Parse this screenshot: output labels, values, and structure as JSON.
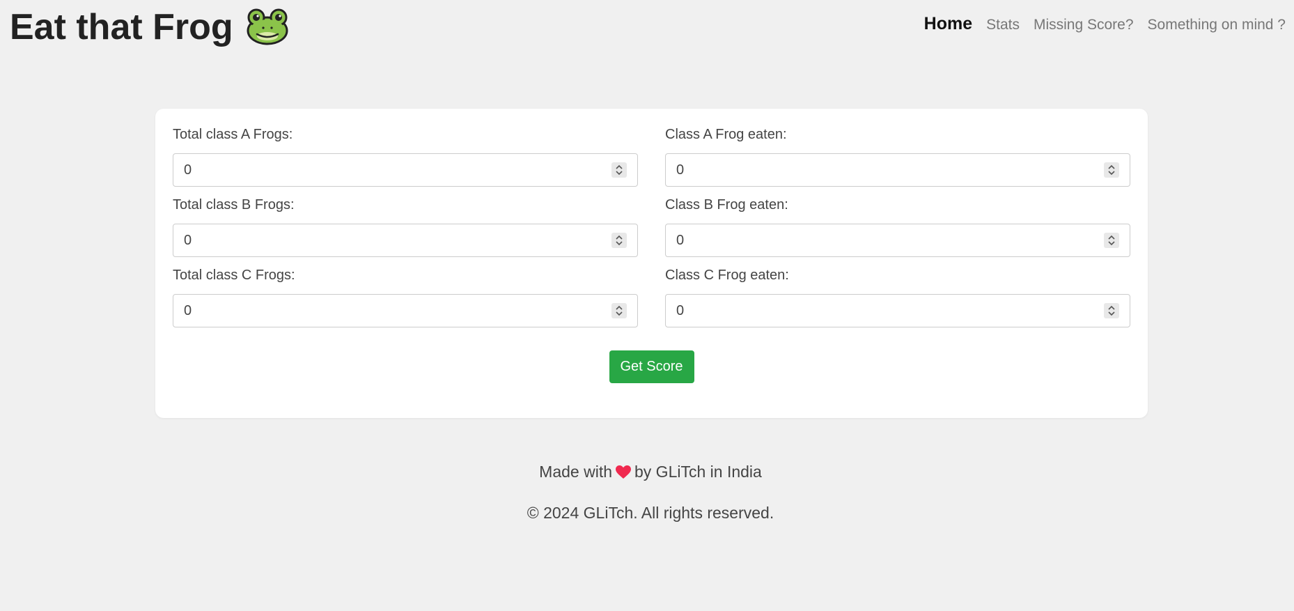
{
  "header": {
    "title": "Eat that Frog",
    "icon": "frog-face-icon"
  },
  "nav": {
    "items": [
      {
        "label": "Home",
        "active": true
      },
      {
        "label": "Stats",
        "active": false
      },
      {
        "label": "Missing Score?",
        "active": false
      },
      {
        "label": "Something on mind ?",
        "active": false
      }
    ]
  },
  "form": {
    "fields": [
      {
        "label": "Total class A Frogs:",
        "value": "0"
      },
      {
        "label": "Class A Frog eaten:",
        "value": "0"
      },
      {
        "label": "Total class B Frogs:",
        "value": "0"
      },
      {
        "label": "Class B Frog eaten:",
        "value": "0"
      },
      {
        "label": "Total class C Frogs:",
        "value": "0"
      },
      {
        "label": "Class C Frog eaten:",
        "value": "0"
      }
    ],
    "submit_label": "Get Score"
  },
  "footer": {
    "made_prefix": "Made with",
    "made_suffix": "by GLiTch in India",
    "heart_icon": "heart-icon",
    "copyright": "© 2024 GLiTch. All rights reserved."
  },
  "colors": {
    "background": "#f0f0f0",
    "card": "#ffffff",
    "button": "#28a745",
    "heart": "#f0294f",
    "frog": "#8bc34a"
  }
}
